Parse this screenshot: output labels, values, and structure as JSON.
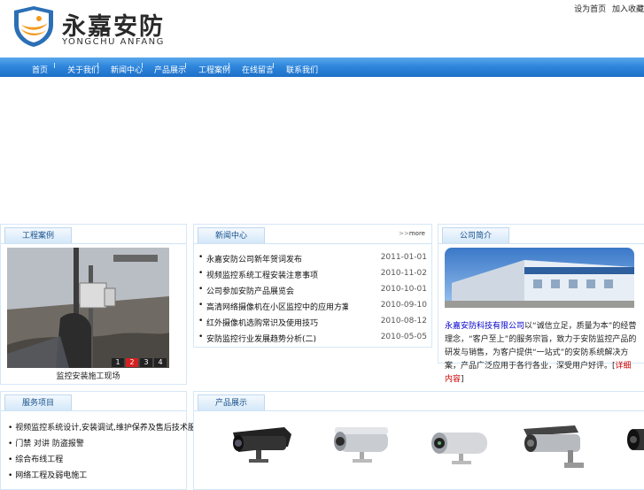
{
  "brand": {
    "name_zh": "永嘉安防",
    "name_en": "YONGCHU ANFANG"
  },
  "top_links": [
    "设为首页",
    "加入收藏"
  ],
  "nav": [
    "首页",
    "关于我们",
    "新闻中心",
    "产品展示",
    "工程案例",
    "在线留言",
    "联系我们"
  ],
  "case_panel": {
    "title": "工程案例",
    "caption": "监控安装施工现场",
    "pages": [
      "1",
      "2",
      "3",
      "4"
    ],
    "active_page": "2"
  },
  "news_panel": {
    "title": "新闻中心",
    "more": "more",
    "items": [
      {
        "title": "永嘉安防公司新年贺词发布",
        "date": "2011-01-01"
      },
      {
        "title": "视频监控系统工程安装注意事项",
        "date": "2010-11-02"
      },
      {
        "title": "公司参加安防产品展览会",
        "date": "2010-10-01"
      },
      {
        "title": "高清网络摄像机在小区监控中的应用方案",
        "date": "2010-09-10"
      },
      {
        "title": "红外摄像机选购常识及使用技巧",
        "date": "2010-08-12"
      },
      {
        "title": "安防监控行业发展趋势分析(二)",
        "date": "2010-05-05"
      }
    ]
  },
  "about_panel": {
    "title": "公司简介",
    "company": "永嘉安防科技有限公司",
    "body": "以“诚信立足，质量为本”的经营理念，“客户至上”的服务宗旨，致力于安防监控产品的研发与销售，为客户提供“一站式”的安防系统解决方案，产品广泛应用于各行各业，深受用户好评。",
    "more": "详细内容"
  },
  "service_panel": {
    "title": "服务项目",
    "items": [
      "视频监控系统设计,安装调试,维护保养及售后技术服务等一条龙服务",
      "门禁 对讲 防盗报警",
      "综合布线工程",
      "网络工程及弱电施工"
    ]
  },
  "product_panel": {
    "title": "产品展示"
  },
  "icons": {
    "dot": "•",
    "more_arrow": ">>"
  },
  "colors": {
    "nav_blue": "#2e86dc",
    "panel_title": "#154f8a",
    "accent_red": "#d42020"
  }
}
